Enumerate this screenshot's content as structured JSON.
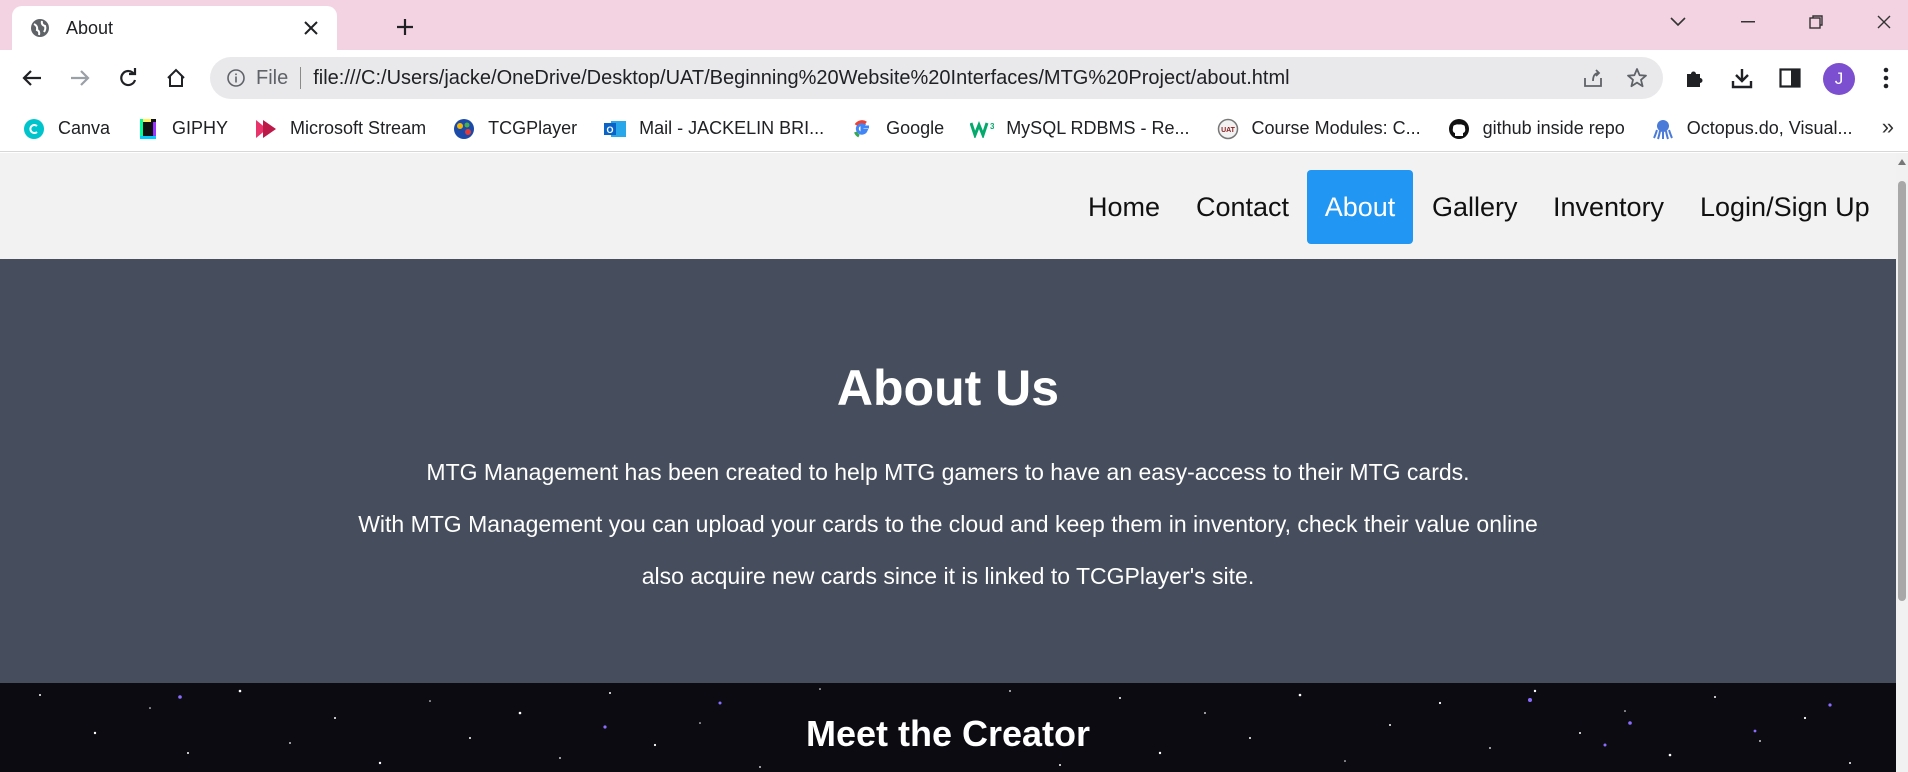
{
  "browser": {
    "tab_title": "About",
    "omnibox": {
      "scheme_label": "File",
      "url": "file:///C:/Users/jacke/OneDrive/Desktop/UAT/Beginning%20Website%20Interfaces/MTG%20Project/about.html"
    },
    "profile_initial": "J",
    "bookmarks": [
      {
        "label": "Canva",
        "icon": "canva-icon",
        "color": "#00c4cc"
      },
      {
        "label": "GIPHY",
        "icon": "giphy-icon",
        "color": "#9933ff"
      },
      {
        "label": "Microsoft Stream",
        "icon": "stream-icon",
        "color": "#bc1948"
      },
      {
        "label": "TCGPlayer",
        "icon": "tcgplayer-icon",
        "color": "#1c4aa8"
      },
      {
        "label": "Mail - JACKELIN BRI...",
        "icon": "outlook-icon",
        "color": "#0a64c7"
      },
      {
        "label": "Google",
        "icon": "google-icon",
        "color": "#4285f4"
      },
      {
        "label": "MySQL RDBMS - Re...",
        "icon": "w3-icon",
        "color": "#04aa6d"
      },
      {
        "label": "Course Modules: C...",
        "icon": "course-icon",
        "color": "#777777"
      },
      {
        "label": "github inside repo",
        "icon": "github-icon",
        "color": "#111111"
      },
      {
        "label": "Octopus.do, Visual...",
        "icon": "octopus-icon",
        "color": "#4a7bd8"
      }
    ],
    "bookmarks_more": "»"
  },
  "site": {
    "nav": [
      "Home",
      "Contact",
      "About",
      "Gallery",
      "Inventory",
      "Login/Sign Up"
    ],
    "active_nav": "About",
    "accent_color": "#2196f3",
    "about": {
      "title": "About Us",
      "lines": [
        "MTG Management has been created to help MTG gamers to have an easy-access to their MTG cards.",
        "With MTG Management you can upload your cards to the cloud and keep them in inventory, check their value online",
        "also acquire new cards since it is linked to TCGPlayer's site."
      ]
    },
    "creator_heading": "Meet the Creator"
  }
}
